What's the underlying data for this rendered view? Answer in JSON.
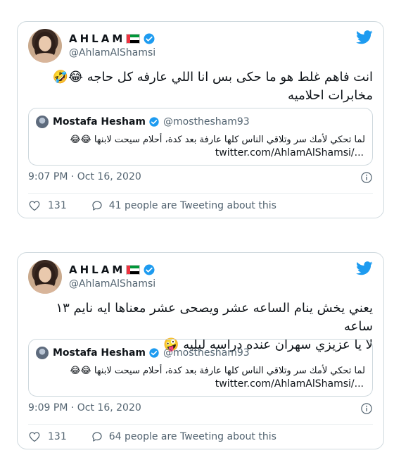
{
  "tweets": [
    {
      "display_name": "AHLAM",
      "handle": "@AhlamAlShamsi",
      "text_line1": "انت فاهم غلط هو ما حكى بس انا اللي عارفه كل حاجه 😂🤣",
      "text_line2": "مخابرات احلاميه",
      "quote": {
        "name": "Mostafa Hesham",
        "handle": "@mosthesham93",
        "text": "لما تحكي لأمك سر وتلاقي الناس كلها عارفة بعد كدة، أحلام سيحت لابنها 😂😂",
        "link": "twitter.com/AhlamAlShamsi/..."
      },
      "timestamp": "9:07 PM · Oct 16, 2020",
      "likes": "131",
      "tweeting_about": "41 people are Tweeting about this"
    },
    {
      "display_name": "AHLAM",
      "handle": "@AhlamAlShamsi",
      "text_line1": "يعني يخش ينام الساعه عشر ويصحى عشر معناها ايه نايم ١٣ ساعه",
      "text_line2": "لا يا عزيزي سهران عنده دراسه ليليه 🤪",
      "quote": {
        "name": "Mostafa Hesham",
        "handle": "@mosthesham93",
        "text": "لما تحكي لأمك سر وتلاقي الناس كلها عارفة بعد كدة، أحلام سيحت لابنها 😂😂",
        "link": "twitter.com/AhlamAlShamsi/..."
      },
      "timestamp": "9:09 PM · Oct 16, 2020",
      "likes": "131",
      "tweeting_about": "64 people are Tweeting about this"
    }
  ],
  "icons": {
    "bird": "twitter-bird-icon",
    "verified": "verified-badge-icon",
    "flag": "uae-flag-icon",
    "info": "info-icon",
    "like": "heart-icon",
    "reply": "reply-bubble-icon"
  },
  "colors": {
    "brand_blue": "#1d9bf0",
    "border": "#cfd9de",
    "secondary_text": "#536471"
  }
}
